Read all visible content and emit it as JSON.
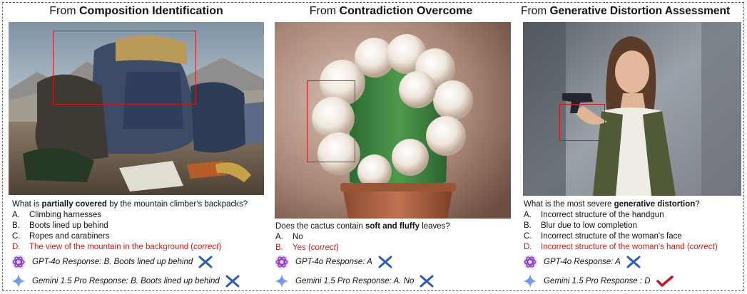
{
  "panels": [
    {
      "title_prefix": "From",
      "title_bold": "Composition Identification",
      "question_pre": "What is",
      "question_bold": "partially covered",
      "question_post": "by the mountain climber's backpacks?",
      "options": [
        {
          "letter": "A.",
          "text": "Climbing harnesses",
          "correct_note": ""
        },
        {
          "letter": "B.",
          "text": "Boots lined up behind",
          "correct_note": ""
        },
        {
          "letter": "C.",
          "text": "Ropes and carabiners",
          "correct_note": ""
        },
        {
          "letter": "D.",
          "text": "The view of the mountain in the background (",
          "correct_note": "correct",
          "close": ")"
        }
      ],
      "responses": [
        {
          "text": "GPT-4o Response: B. Boots lined up behind",
          "logo": "openai-logo-icon",
          "verdict": "cross"
        },
        {
          "text": "Gemini 1.5 Pro Response: B. Boots lined up behind",
          "logo": "gemini-logo-icon",
          "verdict": "cross"
        }
      ]
    },
    {
      "title_prefix": "From",
      "title_bold": "Contradiction Overcome",
      "question_pre": "Does the cactus contain",
      "question_bold": "soft and fluffy",
      "question_post": "leaves?",
      "options": [
        {
          "letter": "A.",
          "text": "No",
          "correct_note": ""
        },
        {
          "letter": "B.",
          "text": "Yes (",
          "correct_note": "correct",
          "close": ")"
        }
      ],
      "responses": [
        {
          "text": "GPT-4o Response: A",
          "logo": "openai-logo-icon",
          "verdict": "cross"
        },
        {
          "text": "Gemini 1.5 Pro Response: A. No",
          "logo": "gemini-logo-icon",
          "verdict": "cross"
        }
      ]
    },
    {
      "title_prefix": "From",
      "title_bold": "Generative Distortion Assessment",
      "question_pre": "What is the most severe",
      "question_bold": "generative distortion",
      "question_post": "?",
      "options": [
        {
          "letter": "A.",
          "text": "Incorrect structure of the handgun",
          "correct_note": ""
        },
        {
          "letter": "B.",
          "text": "Blur due to low completion",
          "correct_note": ""
        },
        {
          "letter": "C.",
          "text": "Incorrect structure of the woman's face",
          "correct_note": ""
        },
        {
          "letter": "D.",
          "text": "Incorrect structure of the woman's hand (",
          "correct_note": "correct",
          "close": ")"
        }
      ],
      "responses": [
        {
          "text": "GPT-4o Response: A",
          "logo": "openai-logo-icon",
          "verdict": "cross"
        },
        {
          "text": "Gemini 1.5 Pro Response : D",
          "logo": "gemini-logo-icon",
          "verdict": "check"
        }
      ]
    }
  ],
  "colors": {
    "highlight": "#d01818",
    "cross": "#2a5db0",
    "check": "#c8141e"
  }
}
